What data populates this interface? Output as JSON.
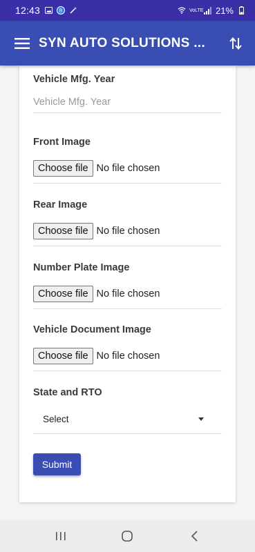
{
  "status_bar": {
    "time": "12:43",
    "battery": "21%",
    "network": "VoLTE"
  },
  "app_bar": {
    "title": "SYN AUTO SOLUTIONS ...",
    "menu_icon": "hamburger-menu-icon",
    "action_icon": "swap-vertical-icon"
  },
  "form": {
    "mfg_year": {
      "label": "Vehicle Mfg. Year",
      "value": "",
      "placeholder": "Vehicle Mfg. Year"
    },
    "front_image": {
      "label": "Front Image",
      "button": "Choose file",
      "status": "No file chosen"
    },
    "rear_image": {
      "label": "Rear Image",
      "button": "Choose file",
      "status": "No file chosen"
    },
    "number_plate_image": {
      "label": "Number Plate Image",
      "button": "Choose file",
      "status": "No file chosen"
    },
    "vehicle_document_image": {
      "label": "Vehicle Document Image",
      "button": "Choose file",
      "status": "No file chosen"
    },
    "state_rto": {
      "label": "State and RTO",
      "selected": "Select"
    },
    "submit_label": "Submit"
  },
  "colors": {
    "status_bar": "#3a2fa6",
    "app_bar": "#3a4db2",
    "submit": "#3a4db2"
  },
  "nav_bar": {
    "recents_icon": "recents-icon",
    "home_icon": "home-icon",
    "back_icon": "back-icon"
  }
}
